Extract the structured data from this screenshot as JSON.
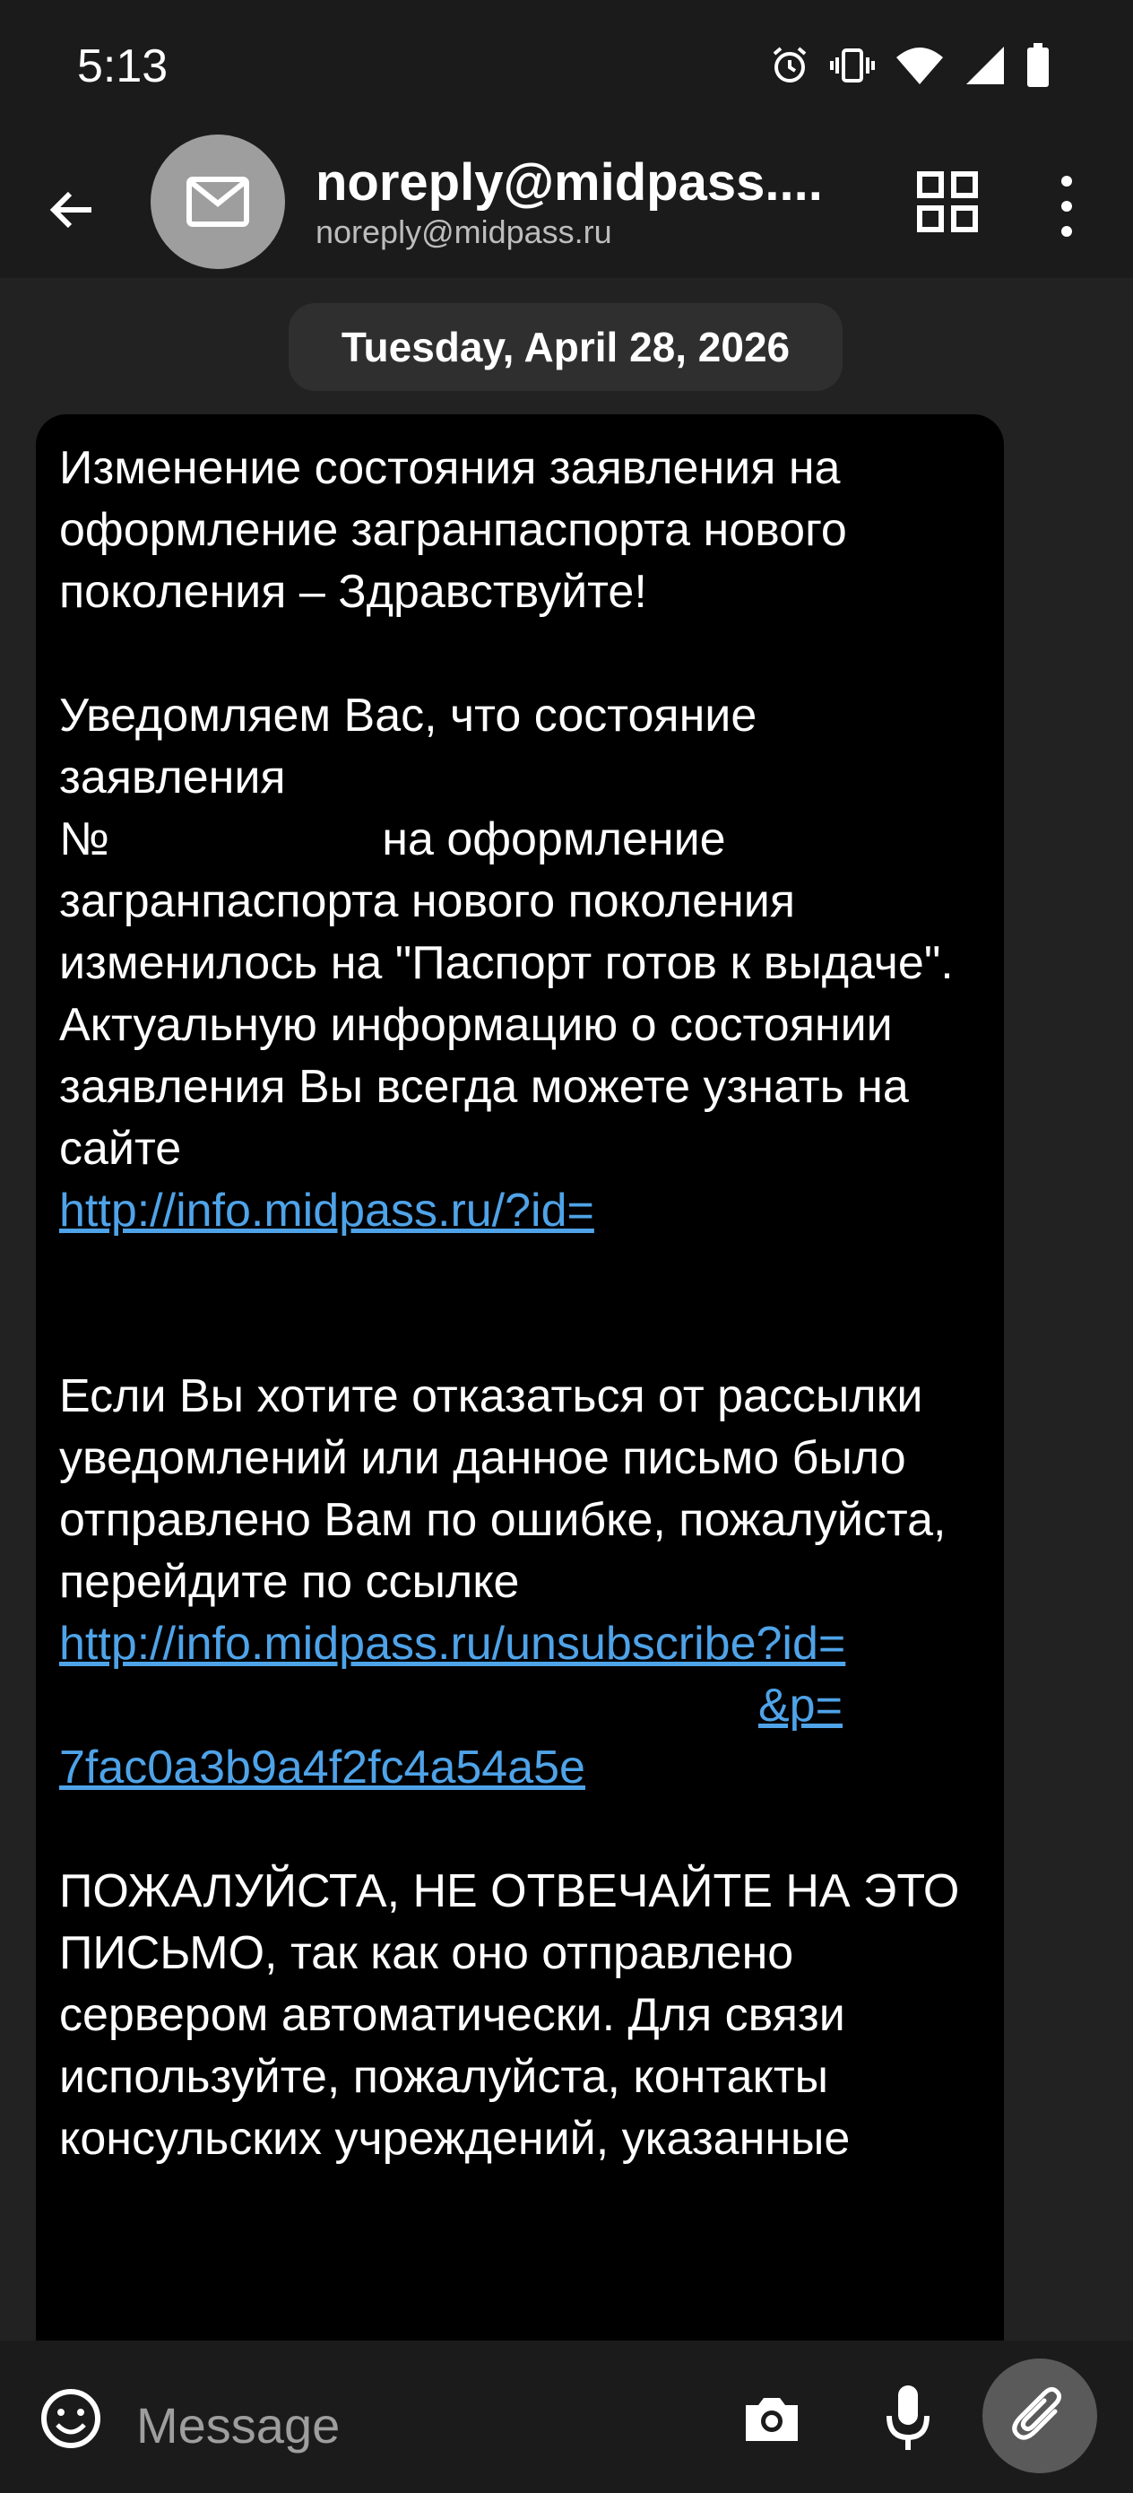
{
  "status_bar": {
    "time": "5:13",
    "icons": [
      "alarm-icon",
      "vibrate-icon",
      "wifi-icon",
      "signal-icon",
      "battery-icon"
    ]
  },
  "header": {
    "title": "noreply@midpass....",
    "subtitle": "noreply@midpass.ru",
    "icons": [
      "back-arrow-icon",
      "mail-icon",
      "qr-grid-icon",
      "more-vert-icon"
    ]
  },
  "chat": {
    "date": "Tuesday, April 28, 2026",
    "message": {
      "p1": "Изменение состояния заявления на оформление загранпаспорта нового поколения – Здравствуйте!",
      "p2_line1": "Уведомляем Вас, что состояние заявления",
      "p2_prefix": "№",
      "p2_after": "на оформление загранпаспорта нового поколения изменилось на \"Паспорт готов к выдаче\".",
      "p3": "Актуальную информацию о состоянии заявления Вы всегда можете узнать на сайте",
      "link1": "http://info.midpass.ru/?id=",
      "p4": "Если Вы хотите отказаться от рассылки уведомлений или данное письмо было отправлено Вам по ошибке, пожалуйста, перейдите по ссылке",
      "link2_line1": "http://info.midpass.ru/unsubscribe?id=",
      "link2_tail": "&p=",
      "link2_line3": "7fac0a3b9a4f2fc4a54a5e",
      "p5": "ПОЖАЛУЙСТА, НЕ ОТВЕЧАЙТЕ НА ЭТО ПИСЬМО, так как оно отправлено сервером автоматически. Для связи используйте, пожалуйста, контакты консульских учреждений, указанные"
    }
  },
  "composer": {
    "placeholder": "Message",
    "icons": [
      "emoji-icon",
      "camera-icon",
      "mic-icon",
      "attach-icon"
    ]
  },
  "colors": {
    "background": "#0d0d0d",
    "bar": "#1b1b1b",
    "chat_bg": "#222222",
    "bubble": "#000000",
    "link": "#4fa3e8",
    "avatar": "#9e9e9e"
  }
}
